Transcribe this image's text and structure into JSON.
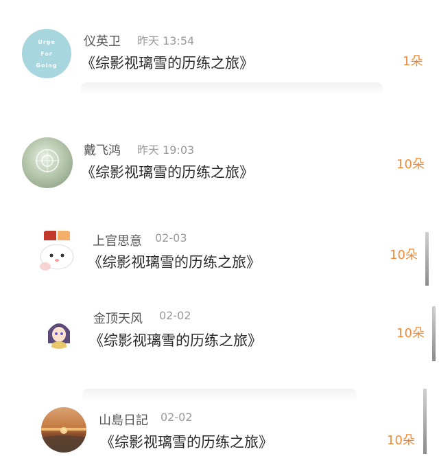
{
  "list": [
    {
      "name": "仪英卫",
      "time": "昨天 13:54",
      "title": "《综影视璃雪的历练之旅》",
      "count": "1朵",
      "avatar_icon": "urge-for-going-avatar",
      "avatar_lines": [
        "Urge",
        "For",
        "Going"
      ]
    },
    {
      "name": "戴飞鸿",
      "time": "昨天 19:03",
      "title": "《综影视璃雪的历练之旅》",
      "count": "10朵",
      "avatar_icon": "pattern-avatar"
    },
    {
      "name": "上官思意",
      "time": "02-03",
      "title": "《综影视璃雪的历练之旅》",
      "count": "10朵",
      "avatar_icon": "cartoon-bunny-avatar"
    },
    {
      "name": "金顶天风",
      "time": "02-02",
      "title": "《综影视璃雪的历练之旅》",
      "count": "10朵",
      "avatar_icon": "anime-girl-avatar"
    },
    {
      "name": "山島日記",
      "time": "02-02",
      "title": "《综影视璃雪的历练之旅》",
      "count": "10朵",
      "avatar_icon": "sunset-avatar"
    }
  ]
}
